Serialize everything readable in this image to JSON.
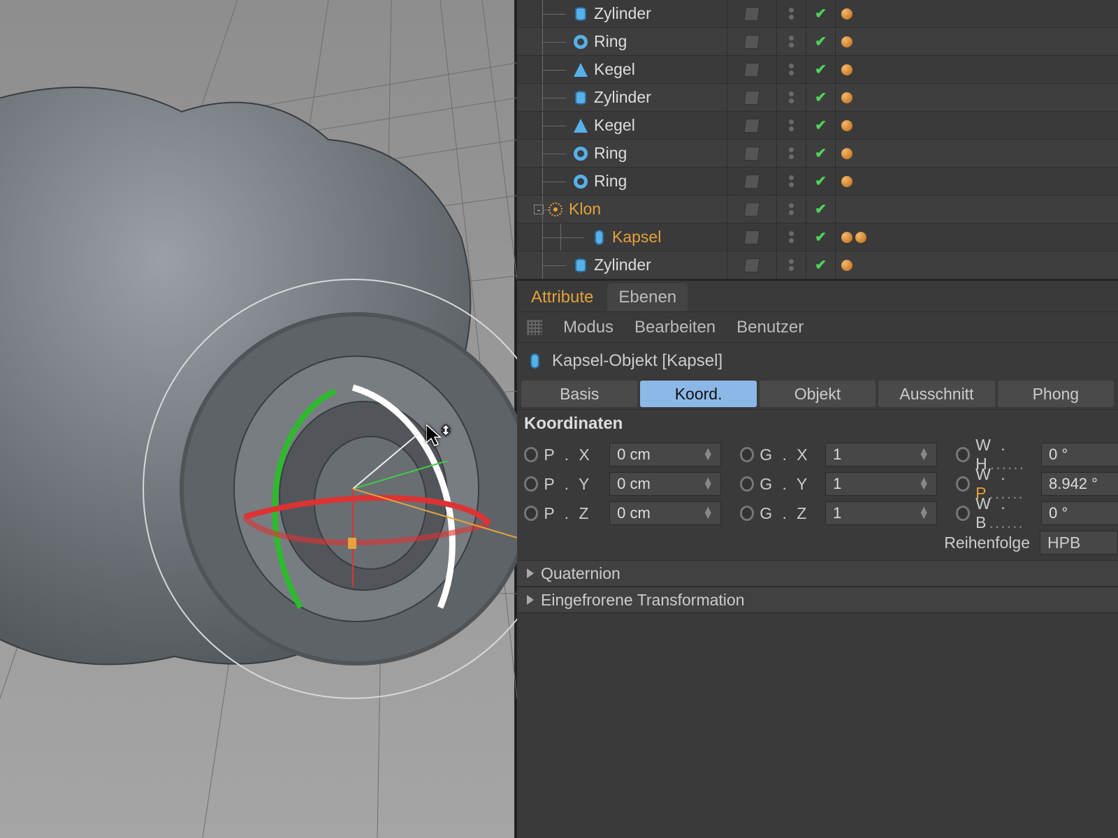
{
  "hierarchy": {
    "items": [
      {
        "name": "Zylinder",
        "icon": "cylinder",
        "indent": 80,
        "tags": 1,
        "selected": false
      },
      {
        "name": "Ring",
        "icon": "ring",
        "indent": 80,
        "tags": 1,
        "selected": false
      },
      {
        "name": "Kegel",
        "icon": "cone",
        "indent": 80,
        "tags": 1,
        "selected": false
      },
      {
        "name": "Zylinder",
        "icon": "cylinder",
        "indent": 80,
        "tags": 1,
        "selected": false
      },
      {
        "name": "Kegel",
        "icon": "cone",
        "indent": 80,
        "tags": 1,
        "selected": false
      },
      {
        "name": "Ring",
        "icon": "ring",
        "indent": 80,
        "tags": 1,
        "selected": false
      },
      {
        "name": "Ring",
        "icon": "ring",
        "indent": 80,
        "tags": 1,
        "selected": false
      },
      {
        "name": "Klon",
        "icon": "clone",
        "indent": 58,
        "tags": 0,
        "selected": true,
        "expander": "-"
      },
      {
        "name": "Kapsel",
        "icon": "capsule",
        "indent": 106,
        "tags": 2,
        "selected": true
      },
      {
        "name": "Zylinder",
        "icon": "cylinder",
        "indent": 80,
        "tags": 1,
        "selected": false
      }
    ]
  },
  "panel_tabs": {
    "attribute": "Attribute",
    "ebenen": "Ebenen"
  },
  "menubar": {
    "modus": "Modus",
    "bearbeiten": "Bearbeiten",
    "benutzer": "Benutzer"
  },
  "object_header": "Kapsel-Objekt [Kapsel]",
  "coord_tabs": {
    "basis": "Basis",
    "koord": "Koord.",
    "objekt": "Objekt",
    "ausschnitt": "Ausschnitt",
    "phong": "Phong"
  },
  "section_title": "Koordinaten",
  "coords": {
    "px": {
      "label": "P . X",
      "value": "0 cm"
    },
    "py": {
      "label": "P . Y",
      "value": "0 cm"
    },
    "pz": {
      "label": "P . Z",
      "value": "0 cm"
    },
    "gx": {
      "label": "G . X",
      "value": "1"
    },
    "gy": {
      "label": "G . Y",
      "value": "1"
    },
    "gz": {
      "label": "G . Z",
      "value": "1"
    },
    "wh": {
      "label": "W . H",
      "value": "0 °"
    },
    "wp": {
      "label": "W . P",
      "value": "8.942 °",
      "hl": true
    },
    "wb": {
      "label": "W . B",
      "value": "0 °"
    }
  },
  "order": {
    "label": "Reihenfolge",
    "value": "HPB"
  },
  "folds": {
    "quaternion": "Quaternion",
    "frozen": "Eingefrorene Transformation"
  }
}
